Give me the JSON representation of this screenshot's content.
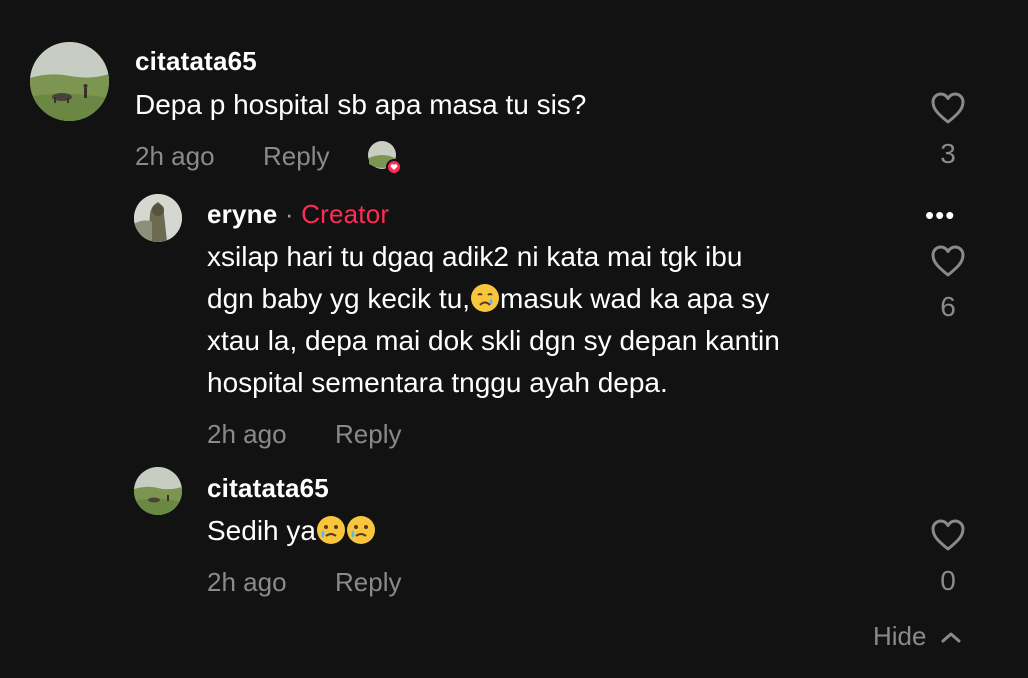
{
  "comments": [
    {
      "username": "citatata65",
      "text": "Depa p hospital sb apa masa tu sis?",
      "time": "2h ago",
      "reply_label": "Reply",
      "likes": "3"
    }
  ],
  "replies": [
    {
      "username": "eryne",
      "separator": "·",
      "badge": "Creator",
      "lines": [
        "xsilap hari tu dgaq adik2 ni kata mai tgk ibu",
        "dgn baby yg kecik tu,",
        "masuk wad ka apa sy",
        "xtau la, depa mai dok skli dgn sy depan kantin",
        "hospital sementara tnggu ayah depa."
      ],
      "time": "2h ago",
      "reply_label": "Reply",
      "likes": "6",
      "more": "•••"
    },
    {
      "username": "citatata65",
      "text": "Sedih ya",
      "time": "2h ago",
      "reply_label": "Reply",
      "likes": "0"
    }
  ],
  "footer": {
    "hide_label": "Hide"
  },
  "colors": {
    "background": "#121212",
    "accent": "#fe2c55",
    "muted": "#8a8a8a"
  },
  "icons": [
    "heart-outline-icon",
    "chevron-up-icon",
    "more-options-icon",
    "crying-face-emoji",
    "tearful-smile-emoji"
  ]
}
